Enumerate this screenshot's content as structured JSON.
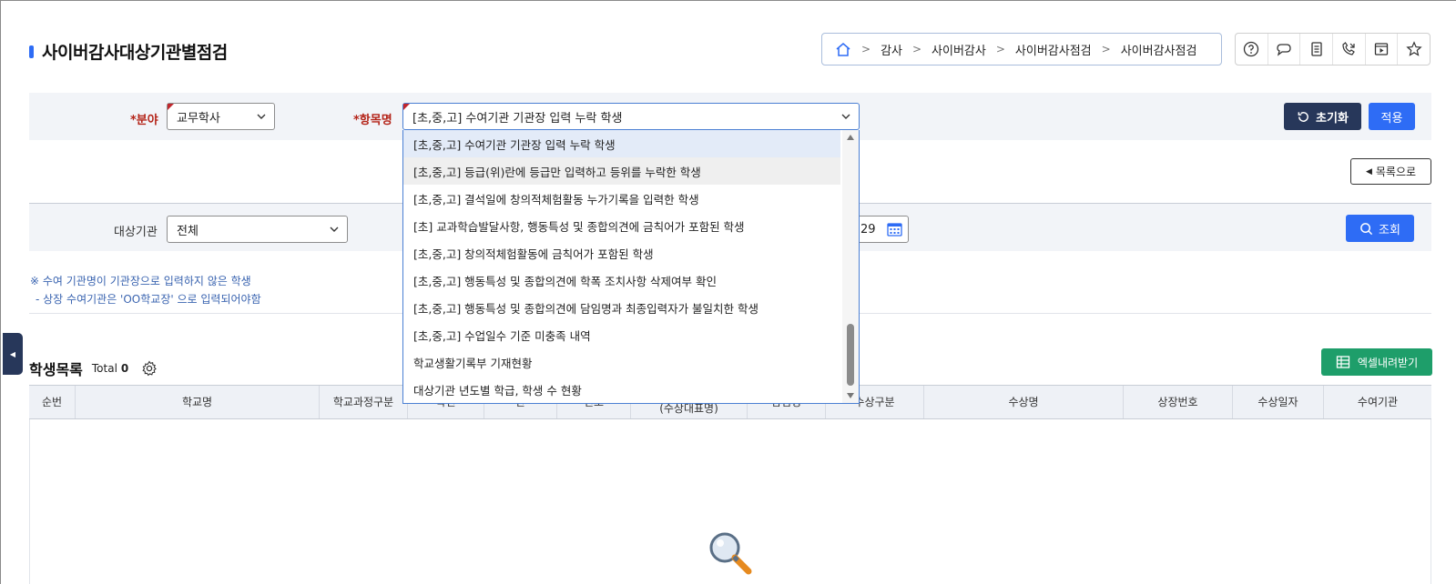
{
  "page": {
    "title": "사이버감사대상기관별점검"
  },
  "breadcrumb": {
    "home_icon": "home-icon",
    "items": [
      "감사",
      "사이버감사",
      "사이버감사점검",
      "사이버감사점검"
    ]
  },
  "toolbar_icons": [
    "help-icon",
    "chat-icon",
    "document-icon",
    "phone-call-icon",
    "video-play-icon",
    "star-icon"
  ],
  "filter1": {
    "field_label": "*분야",
    "field_value": "교무학사",
    "item_label": "*항목명",
    "item_value": "[초,중,고] 수여기관 기관장 입력 누락 학생",
    "reset_label": "초기화",
    "apply_label": "적용"
  },
  "back_button": {
    "label": "목록으로"
  },
  "filter2": {
    "target_label": "대상기관",
    "target_value": "전체",
    "date_value": "29",
    "search_label": "조회"
  },
  "notes": [
    "※ 수여 기관명이 기관장으로 입력하지 않은 학생",
    "- 상장 수여기관은 'OO학교장' 으로 입력되어야함"
  ],
  "student_list": {
    "title": "학생목록",
    "total_label": "Total",
    "total_value": "0",
    "excel_label": "엑셀내려받기",
    "columns": [
      "순번",
      "학교명",
      "학교과정구분",
      "학년",
      "반",
      "번호",
      "성명\n(수상대표명)",
      "담임명",
      "수상구분",
      "수상명",
      "상장번호",
      "수상일자",
      "수여기관"
    ]
  },
  "dropdown": {
    "options": [
      "[초,중,고] 수여기관 기관장 입력 누락 학생",
      "[초,중,고] 등급(위)란에 등급만 입력하고 등위를 누락한 학생",
      "[초,중,고] 결석일에 창의적체험활동 누가기록을 입력한 학생",
      "[초] 교과학습발달사항, 행동특성 및 종합의견에 금칙어가 포함된 학생",
      "[초,중,고] 창의적체험활동에 금칙어가 포함된 학생",
      "[초,중,고] 행동특성 및 종합의견에 학폭 조치사항 삭제여부 확인",
      "[초,중,고] 행동특성 및 종합의견에 담임명과 최종입력자가 불일치한 학생",
      "[초,중,고] 수업일수 기준 미충족 내역",
      "학교생활기록부 기재현황",
      "대상기관 년도별 학급, 학생 수 현황"
    ]
  },
  "colors": {
    "primary": "#2e6cf5",
    "navy": "#27375a",
    "excel": "#1e9e6a",
    "required": "#b42318"
  }
}
